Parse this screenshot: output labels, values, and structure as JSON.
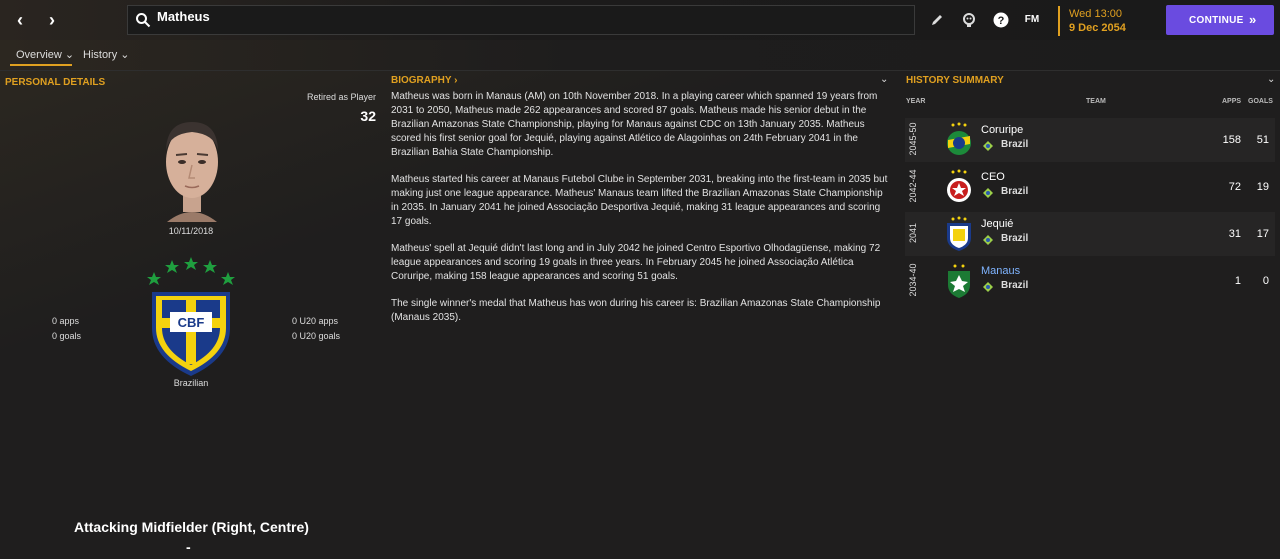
{
  "header": {
    "search_value": "Matheus",
    "date_day": "Wed 13:00",
    "date_date": "9 Dec 2054",
    "continue_label": "CONTINUE",
    "fm_label": "FM",
    "accent_color": "#e0a020",
    "continue_color": "#6a4be0"
  },
  "tabs": [
    {
      "label": "Overview ⌄"
    },
    {
      "label": "History ⌄"
    }
  ],
  "personal": {
    "title": "PERSONAL DETAILS",
    "retired_label": "Retired as Player",
    "retired_age": "32",
    "dob": "10/11/2018",
    "apps": "0 apps",
    "goals": "0 goals",
    "u20_apps": "0 U20 apps",
    "u20_goals": "0 U20 goals",
    "nationality": "Brazilian",
    "crest_text": "CBF",
    "position": "Attacking Midfielder (Right, Centre)",
    "position_sub": "-"
  },
  "biography": {
    "title": "BIOGRAPHY ›",
    "paragraphs": [
      "Matheus was born in Manaus (AM) on 10th November 2018. In a playing career which spanned 19 years from 2031 to 2050, Matheus made 262 appearances and scored 87 goals. Matheus made his senior debut in the Brazilian Amazonas State Championship, playing for Manaus against CDC on 13th January 2035. Matheus scored his first senior goal for Jequié, playing against Atlético de Alagoinhas on 24th February 2041 in the Brazilian Bahia State Championship.",
      "Matheus started his career at Manaus Futebol Clube in September 2031, breaking into the first-team in 2035 but making just one league appearance. Matheus' Manaus team lifted the Brazilian Amazonas State Championship in 2035. In January 2041 he joined Associação Desportiva Jequié, making 31 league appearances and scoring 17 goals.",
      "Matheus' spell at Jequié didn't last long and in July 2042 he joined Centro Esportivo Olhodagüense, making 72 league appearances and scoring 19 goals in three years. In February 2045 he joined Associação Atlética Coruripe, making 158 league appearances and scoring 51 goals.",
      "The single winner's medal that Matheus has won during his career is: Brazilian Amazonas State Championship (Manaus 2035)."
    ]
  },
  "history": {
    "title": "HISTORY SUMMARY",
    "col_year": "YEAR",
    "col_team": "TEAM",
    "col_apps": "APPS",
    "col_goals": "GOALS",
    "rows": [
      {
        "year": "2045-50",
        "team": "Coruripe",
        "nation": "Brazil",
        "apps": "158",
        "goals": "51"
      },
      {
        "year": "2042-44",
        "team": "CEO",
        "nation": "Brazil",
        "apps": "72",
        "goals": "19"
      },
      {
        "year": "2041",
        "team": "Jequié",
        "nation": "Brazil",
        "apps": "31",
        "goals": "17"
      },
      {
        "year": "2034-40",
        "team": "Manaus",
        "nation": "Brazil",
        "apps": "1",
        "goals": "0"
      }
    ]
  }
}
